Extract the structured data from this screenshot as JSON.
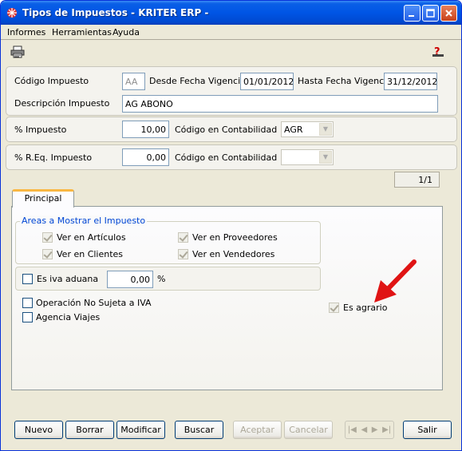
{
  "window": {
    "title": "Tipos de Impuestos - KRITER ERP -"
  },
  "menu": [
    "Informes",
    "Herramientas",
    "Ayuda"
  ],
  "header": {
    "codigo_label": "Código Impuesto",
    "codigo_value": "AA",
    "desde_label": "Desde Fecha Vigencia",
    "desde_value": "01/01/2012",
    "hasta_label": "Hasta Fecha Vigencia",
    "hasta_value": "31/12/2012",
    "descripcion_label": "Descripción Impuesto",
    "descripcion_value": "AG ABONO"
  },
  "impuesto": {
    "label": "% Impuesto",
    "value": "10,00",
    "contab_label": "Código en Contabilidad",
    "contab_value": "AGR"
  },
  "req": {
    "label": "% R.Eq. Impuesto",
    "value": "0,00",
    "contab_label": "Código en Contabilidad",
    "contab_value": ""
  },
  "record_counter": "1/1",
  "tab": {
    "label": "Principal"
  },
  "areas": {
    "title": "Areas a Mostrar el Impuesto",
    "articulos": "Ver en Artículos",
    "proveedores": "Ver en Proveedores",
    "clientes": "Ver en Clientes",
    "vendedores": "Ver en Vendedores"
  },
  "iva_aduana": {
    "label": "Es iva aduana",
    "value": "0,00",
    "unit": "%"
  },
  "no_sujeta": "Operación No Sujeta a IVA",
  "agencia": "Agencia Viajes",
  "agrario": "Es agrario",
  "buttons": {
    "nuevo": "Nuevo",
    "borrar": "Borrar",
    "modificar": "Modificar",
    "buscar": "Buscar",
    "aceptar": "Aceptar",
    "cancelar": "Cancelar",
    "salir": "Salir"
  },
  "icons": {
    "print": "printer-icon",
    "help": "help-icon",
    "app": "app-icon"
  },
  "colors": {
    "titlebar": "#0055e5",
    "accent_arrow": "#e01414",
    "group_title": "#0046d5"
  }
}
